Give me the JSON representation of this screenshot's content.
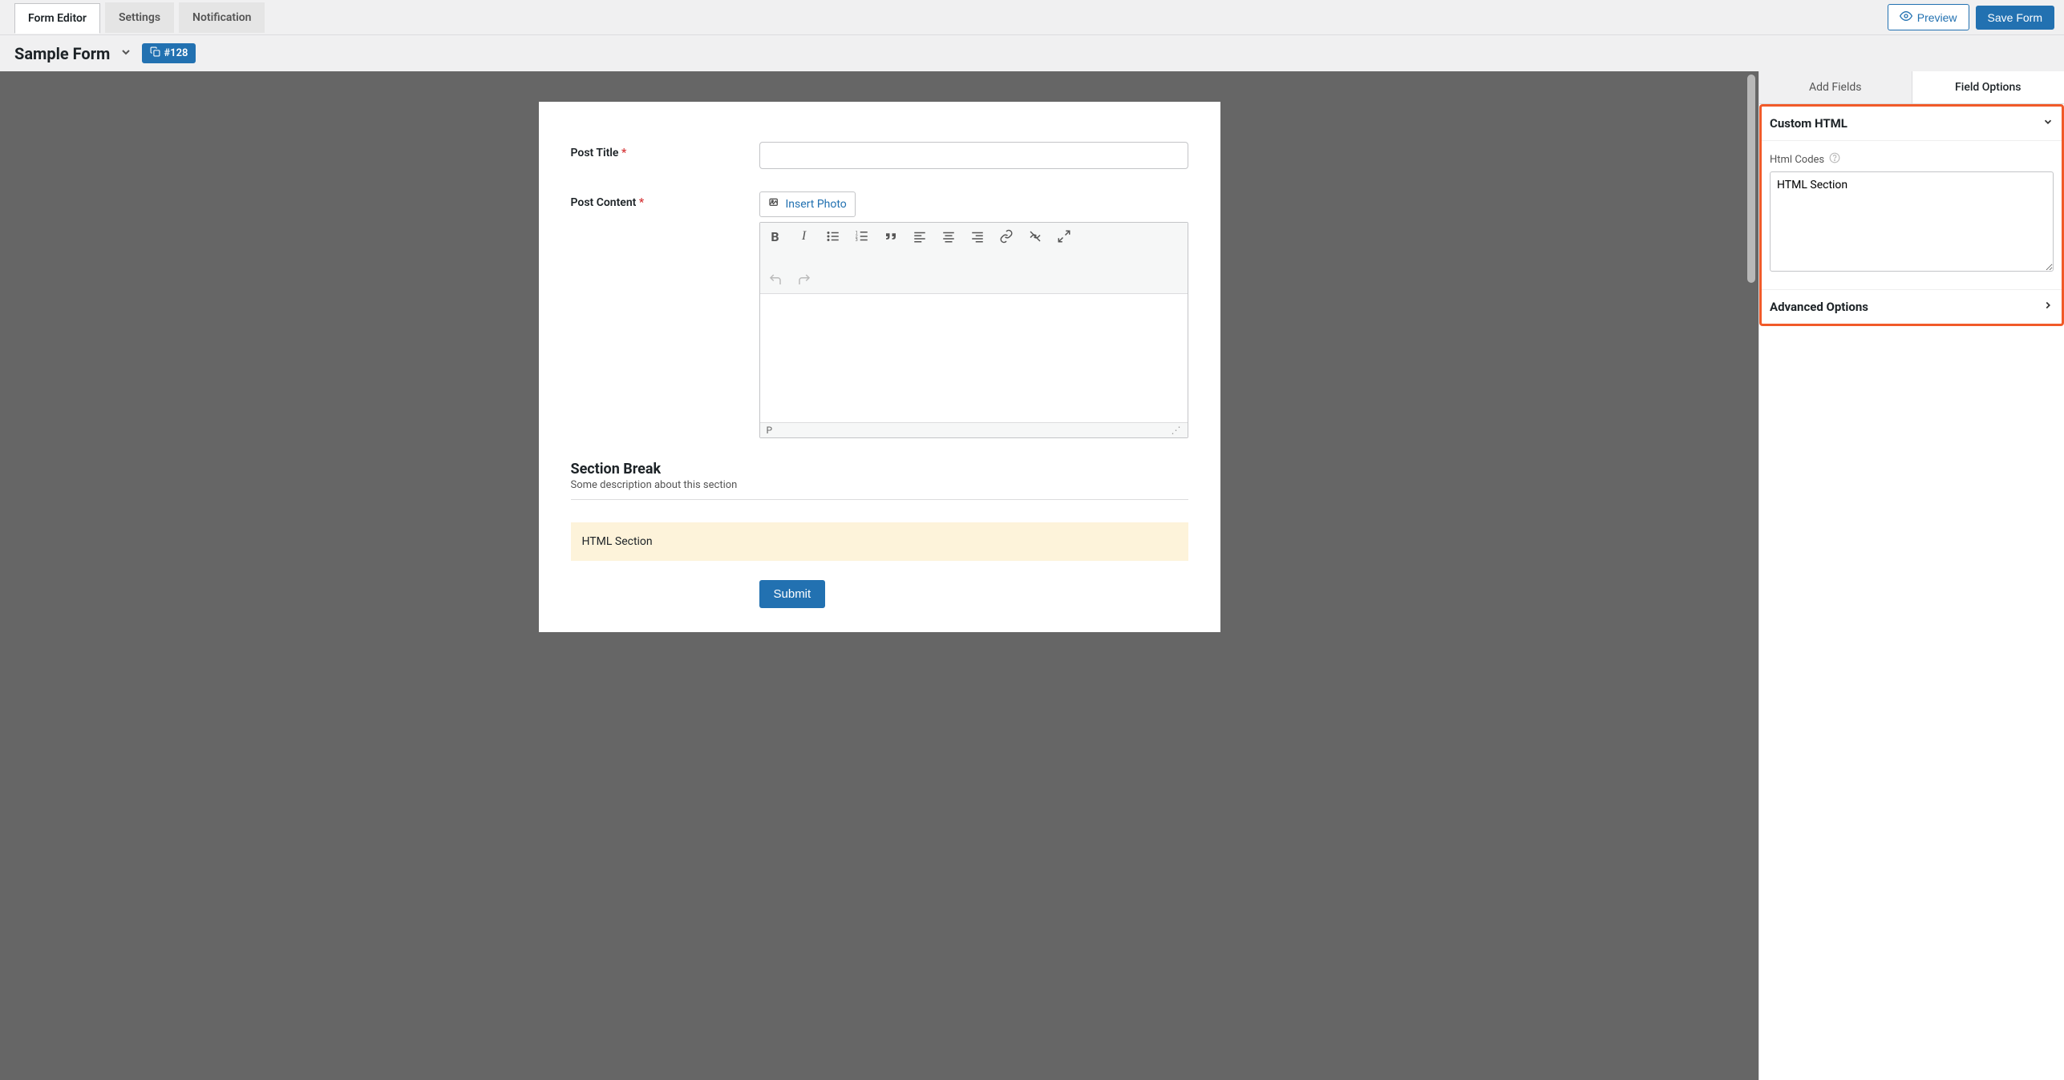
{
  "topbar": {
    "tabs": [
      "Form Editor",
      "Settings",
      "Notification"
    ],
    "preview_label": "Preview",
    "save_label": "Save Form"
  },
  "header": {
    "form_name": "Sample Form",
    "badge": "#128"
  },
  "form": {
    "post_title_label": "Post Title",
    "post_content_label": "Post Content",
    "insert_photo_label": "Insert Photo",
    "editor_path": "P",
    "section_break_title": "Section Break",
    "section_break_desc": "Some description about this section",
    "html_block_text": "HTML Section",
    "submit_label": "Submit"
  },
  "sidebar": {
    "tabs": [
      "Add Fields",
      "Field Options"
    ],
    "custom_html_title": "Custom HTML",
    "html_codes_label": "Html Codes",
    "html_codes_value": "HTML Section",
    "advanced_options_title": "Advanced Options"
  }
}
